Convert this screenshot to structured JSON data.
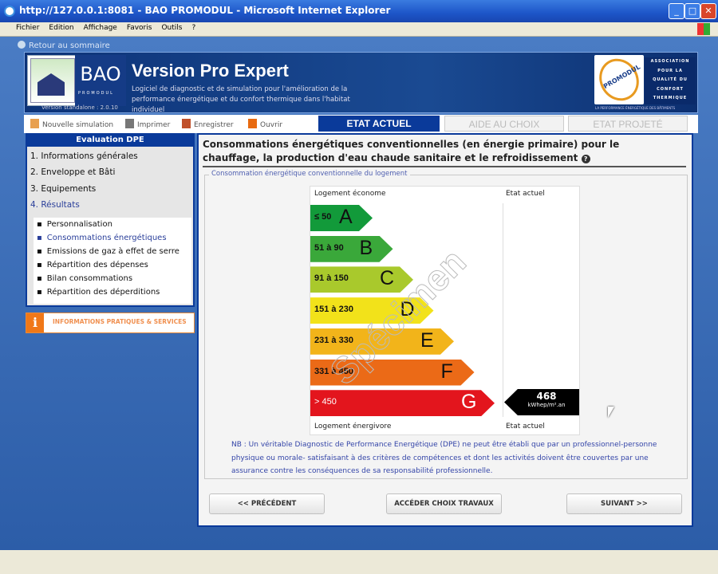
{
  "window": {
    "title": "http://127.0.0.1:8081 - BAO PROMODUL - Microsoft Internet Explorer",
    "min": "_",
    "max": "□",
    "close": "✕"
  },
  "menu": [
    "Fichier",
    "Edition",
    "Affichage",
    "Favoris",
    "Outils",
    "?"
  ],
  "app": {
    "back_link": "Retour au sommaire",
    "logo_text": "BAO",
    "logo_sub": "PROMODUL",
    "version": "Version standalone : 2.0.10",
    "title": "Version Pro Expert",
    "subtitle": "Logiciel de diagnostic et de simulation pour l'amélioration de la performance énergétique et du confort thermique dans l'habitat individuel",
    "partner_logo": "PROMODUL",
    "partner_text": "ASSOCIATION POUR LA QUALITÉ DU CONFORT THERMIQUE",
    "partner_tagline": "LA PERFORMANCE ÉNERGÉTIQUE DES BÂTIMENTS"
  },
  "toolbar": {
    "new": "Nouvelle simulation",
    "print": "Imprimer",
    "save": "Enregistrer",
    "open": "Ouvrir"
  },
  "tabs": {
    "current": "ETAT ACTUEL",
    "help": "AIDE AU CHOIX",
    "projected": "ETAT PROJETÉ"
  },
  "sidebar": {
    "header": "Evaluation DPE",
    "steps": [
      "1. Informations générales",
      "2. Enveloppe et Bâti",
      "3. Equipements",
      "4. Résultats"
    ],
    "sub": [
      "Personnalisation",
      "Consommations énergétiques",
      "Emissions de gaz à effet de serre",
      "Répartition des dépenses",
      "Bilan consommations",
      "Répartition des déperditions"
    ],
    "info_icon": "i",
    "info": "INFORMATIONS PRATIQUES & SERVICES"
  },
  "main": {
    "title": "Consommations énergétiques conventionnelles (en énergie primaire) pour le chauffage, la production d'eau chaude sanitaire et le refroidissement",
    "help": "?",
    "legend": "Consommation énergétique conventionnelle du logement",
    "top_left": "Logement économe",
    "top_right": "Etat actuel",
    "bottom_left": "Logement énergivore",
    "bottom_right": "Etat actuel",
    "watermark": "Spécimen",
    "classes": [
      {
        "range": "≤ 50",
        "letter": "A",
        "color": "#129a3a"
      },
      {
        "range": "51 à 90",
        "letter": "B",
        "color": "#3aa83a"
      },
      {
        "range": "91 à 150",
        "letter": "C",
        "color": "#a9c92c"
      },
      {
        "range": "151 à 230",
        "letter": "D",
        "color": "#f2e21a"
      },
      {
        "range": "231 à 330",
        "letter": "E",
        "color": "#f2b41a"
      },
      {
        "range": "331 à 450",
        "letter": "F",
        "color": "#eb6a17"
      },
      {
        "range": "> 450",
        "letter": "G",
        "color": "#e3151d"
      }
    ],
    "value": "468",
    "unit": "kWhep/m².an",
    "nb": "NB : Un véritable Diagnostic de Performance Energétique (DPE) ne peut être établi que par un professionnel-personne physique ou morale- satisfaisant à des critères de compétences et dont les activités doivent être couvertes par une assurance contre les conséquences de sa responsabilité professionnelle.",
    "prev": "<< PRÉCÉDENT",
    "works": "ACCÉDER CHOIX TRAVAUX",
    "next": "SUIVANT >>"
  }
}
